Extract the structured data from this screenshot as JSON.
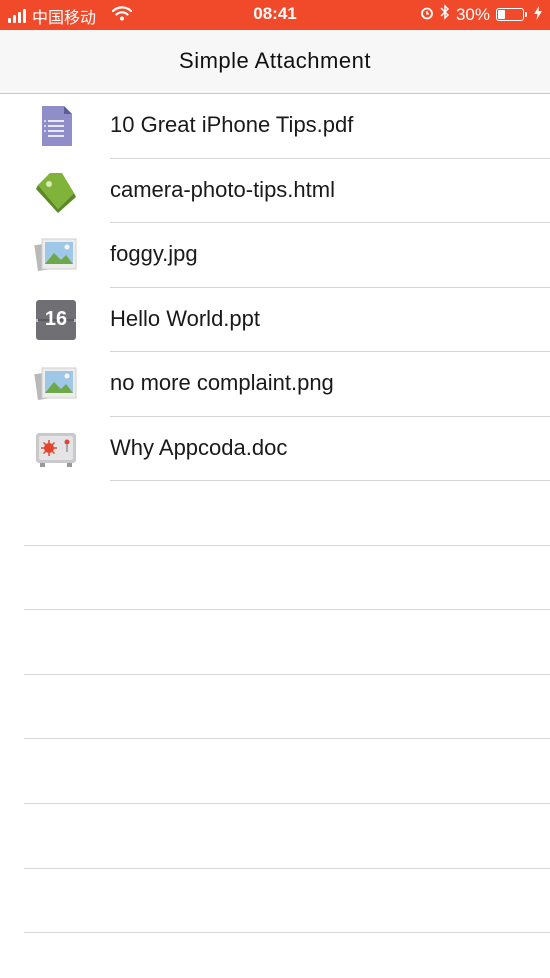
{
  "status_bar": {
    "carrier": "中国移动",
    "time": "08:41",
    "battery_percent": "30%",
    "battery_level": 0.3,
    "icons": [
      "signal-icon",
      "wifi-icon",
      "alarm-icon",
      "bluetooth-icon",
      "battery-icon",
      "charging-icon"
    ]
  },
  "nav": {
    "title": "Simple Attachment"
  },
  "files": [
    {
      "name": "10 Great iPhone Tips.pdf",
      "icon": "document-icon"
    },
    {
      "name": "camera-photo-tips.html",
      "icon": "tag-icon"
    },
    {
      "name": "foggy.jpg",
      "icon": "photo-icon"
    },
    {
      "name": "Hello World.ppt",
      "icon": "calendar-icon",
      "icon_text": "16"
    },
    {
      "name": "no more complaint.png",
      "icon": "photo-icon"
    },
    {
      "name": "Why Appcoda.doc",
      "icon": "safe-icon"
    }
  ],
  "colors": {
    "status_bar_bg": "#f04a2b",
    "nav_bg": "#f7f7f7",
    "separator": "#d6d6da"
  }
}
